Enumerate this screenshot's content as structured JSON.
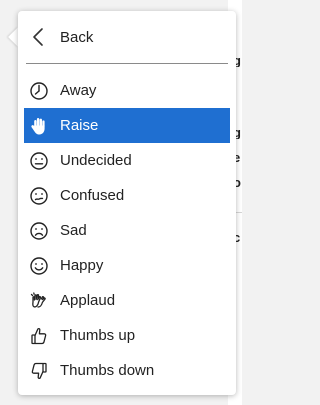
{
  "menu": {
    "back_label": "Back",
    "selected_index": 1,
    "items": [
      {
        "label": "Away",
        "icon": "clock-icon"
      },
      {
        "label": "Raise",
        "icon": "raised-hand-icon"
      },
      {
        "label": "Undecided",
        "icon": "neutral-face-icon"
      },
      {
        "label": "Confused",
        "icon": "confused-face-icon"
      },
      {
        "label": "Sad",
        "icon": "sad-face-icon"
      },
      {
        "label": "Happy",
        "icon": "happy-face-icon"
      },
      {
        "label": "Applaud",
        "icon": "clapping-hands-icon"
      },
      {
        "label": "Thumbs up",
        "icon": "thumbs-up-icon"
      },
      {
        "label": "Thumbs down",
        "icon": "thumbs-down-icon"
      }
    ]
  },
  "colors": {
    "selected_bg": "#1f6fd1",
    "selected_text": "#ffffff",
    "text": "#222222",
    "divider": "#8a8a8a"
  }
}
